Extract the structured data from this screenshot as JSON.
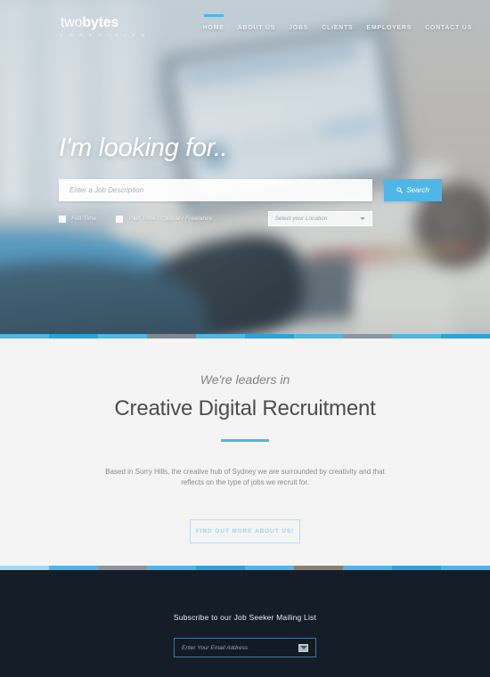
{
  "header": {
    "logo": {
      "part1": "two",
      "part2": "bytes",
      "tagline": "c o n s u l t i n g"
    },
    "nav": [
      {
        "label": "HOME",
        "active": true
      },
      {
        "label": "ABOUT US",
        "active": false
      },
      {
        "label": "JOBS",
        "active": false
      },
      {
        "label": "CLIENTS",
        "active": false
      },
      {
        "label": "EMPLOYERS",
        "active": false
      },
      {
        "label": "CONTACT US",
        "active": false
      }
    ]
  },
  "hero": {
    "title": "I'm looking for..",
    "search": {
      "placeholder": "Enter a Job Description",
      "value": "",
      "button_label": "Search",
      "icon": "search-icon"
    },
    "filters": [
      {
        "label": "Full Time",
        "checked": false
      },
      {
        "label": "Part Time / Casual / Freelance",
        "checked": false
      }
    ],
    "location": {
      "placeholder": "Select your Location",
      "icon": "chevron-down-icon"
    }
  },
  "leaders": {
    "kicker": "We're leaders in",
    "title": "Creative Digital Recruitment",
    "body": "Based in Surry Hills, the creative hub of Sydney we are surrounded by creativity and that reflects on the type of jobs we recruit for.",
    "cta_label": "FIND OUT MORE ABOUT US!"
  },
  "footer": {
    "title": "Subscribe to our Job Seeker Mailing List",
    "email": {
      "placeholder": "Enter Your Email Address",
      "value": "",
      "submit_icon": "envelope-icon"
    }
  },
  "colors": {
    "accent_blue": "#4fb6e8",
    "footer_bg": "#151d28",
    "section_bg": "#f4f4f4",
    "heading_gray": "#4d4d4d"
  },
  "dividers": {
    "top": [
      "#4fb6e8",
      "#2aa2dd",
      "#4fb6e8",
      "#7f8a90",
      "#4fb6e8",
      "#2aa2dd",
      "#4fb6e8",
      "#8d969c",
      "#4fb6e8",
      "#2aa2dd"
    ],
    "bottom": [
      "#9fd9f2",
      "#4fb6e8",
      "#8b949a",
      "#4fb6e8",
      "#2aa2dd",
      "#4fb6e8",
      "#8b7f74",
      "#4fb6e8",
      "#2aa2dd",
      "#4fb6e8"
    ]
  }
}
